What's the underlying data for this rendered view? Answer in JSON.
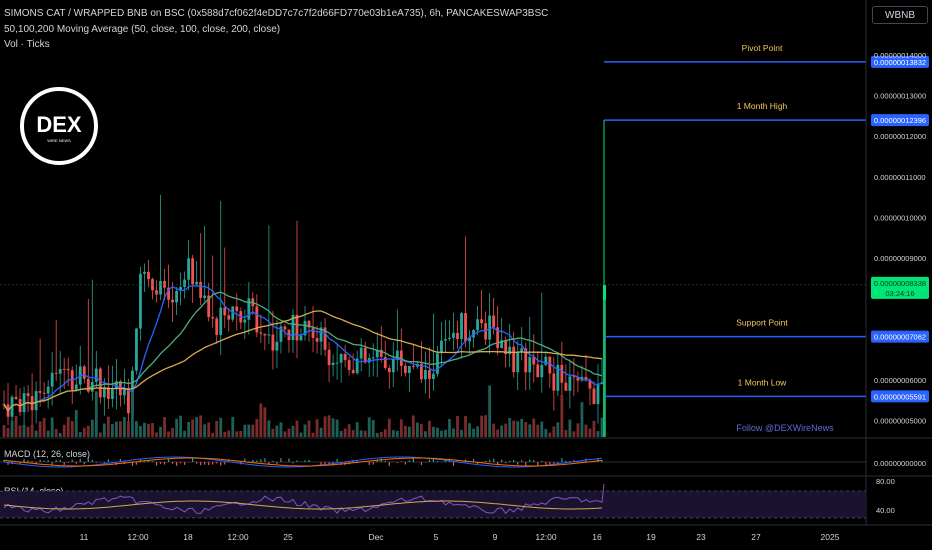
{
  "header": {
    "title": "SIMONS CAT / WRAPPED BNB on BSC (0x588d7cf062f4eDD7c7c7f2d66FD770e03b1eA735), 6h, PANCAKESWAP3BSC",
    "ma_label": "50,100,200 Moving Average (50, close, 100, close, 200, close)",
    "vol_label": "Vol · Ticks"
  },
  "quote_button": "WBNB",
  "logo": {
    "text": "DEX",
    "sub": "WIRE NEWS"
  },
  "watermark": "Follow @DEXWireNews",
  "levels": [
    {
      "name": "Pivot Point",
      "value": "0.00000013832",
      "price": 1.3832e-07
    },
    {
      "name": "1 Month High",
      "value": "0.00000012396",
      "price": 1.2396e-07
    },
    {
      "name": "Support Point",
      "value": "0.00000007062",
      "price": 7.062e-08
    },
    {
      "name": "1 Month Low",
      "value": "0.00000005591",
      "price": 5.591e-08
    }
  ],
  "current_price": {
    "value": "0.00000008338",
    "countdown": "03:24:16",
    "price": 8.338e-08
  },
  "price_axis": {
    "ticks": [
      "0.00000014000",
      "0.00000013000",
      "0.00000012000",
      "0.00000011000",
      "0.00000010000",
      "0.00000009000",
      "0.00000006000",
      "0.00000005000"
    ],
    "tick_values": [
      1.4e-07,
      1.3e-07,
      1.2e-07,
      1.1e-07,
      1e-07,
      9e-08,
      6e-08,
      5e-08
    ]
  },
  "time_axis": [
    "11",
    "12:00",
    "18",
    "12:00",
    "25",
    "Dec",
    "5",
    "9",
    "12:00",
    "16",
    "19",
    "23",
    "27",
    "2025"
  ],
  "macd": {
    "label": "MACD (12, 26, close)",
    "value": "0.00000000000"
  },
  "rsi": {
    "label": "RSI (14, close)",
    "ticks": [
      "80.00",
      "40.00"
    ]
  },
  "colors": {
    "up": "#26a69a",
    "down": "#ef5350",
    "ma50": "#2962ff",
    "ma100": "#4caf7a",
    "ma200": "#d8a94e",
    "level": "#2962ff",
    "level_text": "#f0c95a",
    "current": "#00e676"
  }
}
